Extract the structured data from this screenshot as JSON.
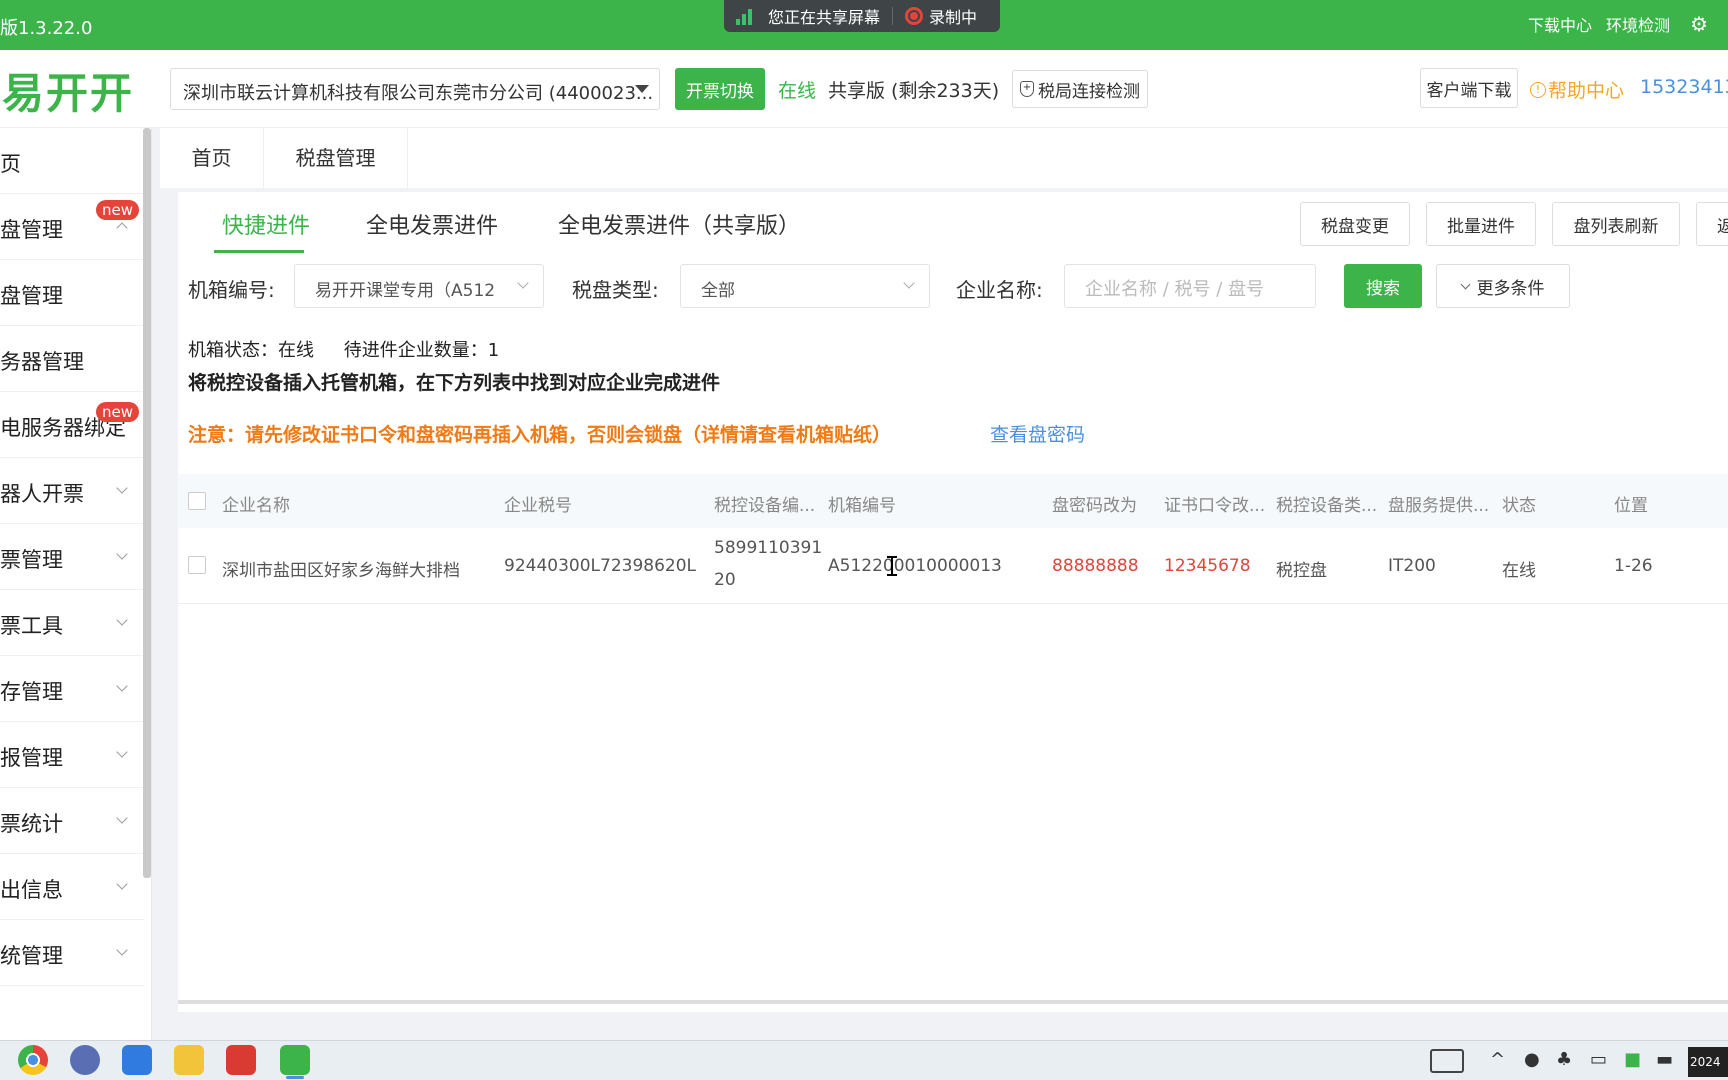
{
  "topbar": {
    "version": "版1.3.22.0",
    "sharing_text": "您正在共享屏幕",
    "recording_text": "录制中",
    "download_center": "下载中心",
    "env_check": "环境检测"
  },
  "header": {
    "logo": "易开开",
    "company": "深圳市联云计算机科技有限公司东莞市分公司 (4400023...",
    "switch_btn": "开票切换",
    "online": "在线",
    "shared_version": "共享版 (剩余233天)",
    "tax_check": "税局连接检测",
    "client_download": "客户端下载",
    "help_center": "帮助中心",
    "phone": "15323413"
  },
  "sidebar": {
    "items": [
      {
        "label": "页"
      },
      {
        "label": "盘管理",
        "badge": "new"
      },
      {
        "label": "盘管理"
      },
      {
        "label": "务器管理"
      },
      {
        "label": "电服务器绑定",
        "badge": "new"
      },
      {
        "label": "器人开票"
      },
      {
        "label": "票管理"
      },
      {
        "label": "票工具"
      },
      {
        "label": "存管理"
      },
      {
        "label": "报管理"
      },
      {
        "label": "票统计"
      },
      {
        "label": "出信息"
      },
      {
        "label": "统管理"
      }
    ]
  },
  "top_tabs": [
    "首页",
    "税盘管理"
  ],
  "sub_tabs": [
    "快捷进件",
    "全电发票进件",
    "全电发票进件（共享版）"
  ],
  "toolbar": {
    "change": "税盘变更",
    "batch": "批量进件",
    "refresh": "盘列表刷新",
    "extra": "返"
  },
  "filters": {
    "box_label": "机箱编号:",
    "box_value": "易开开课堂专用（A512",
    "type_label": "税盘类型:",
    "type_value": "全部",
    "company_label": "企业名称:",
    "company_placeholder": "企业名称 / 税号 / 盘号",
    "search": "搜索",
    "more": "更多条件"
  },
  "info": {
    "status": "机箱状态：在线",
    "pending": "待进件企业数量：1",
    "instruction": "将税控设备插入托管机箱，在下方列表中找到对应企业完成进件",
    "notice": "注意：请先修改证书口令和盘密码再插入机箱，否则会锁盘（详情请查看机箱贴纸）",
    "notice_link": "查看盘密码"
  },
  "table": {
    "headers": [
      "企业名称",
      "企业税号",
      "税控设备编...",
      "机箱编号",
      "盘密码改为",
      "证书口令改...",
      "税控设备类...",
      "盘服务提供...",
      "状态",
      "位置"
    ],
    "rows": [
      {
        "name": "深圳市盐田区好家乡海鲜大排档",
        "tax_no": "92440300L72398620L",
        "device_no_1": "5899110391",
        "device_no_2": "20",
        "box_no": "A512200010000013",
        "pwd": "88888888",
        "cert_pwd": "12345678",
        "device_type": "税控盘",
        "provider": "IT200",
        "status": "在线",
        "position": "1-26"
      }
    ]
  },
  "taskbar": {
    "time": "2024"
  },
  "colors": {
    "brand_green": "#3cb44a",
    "warn_orange": "#f07a14",
    "error_red": "#e4443a",
    "link_blue": "#4a90e2"
  }
}
